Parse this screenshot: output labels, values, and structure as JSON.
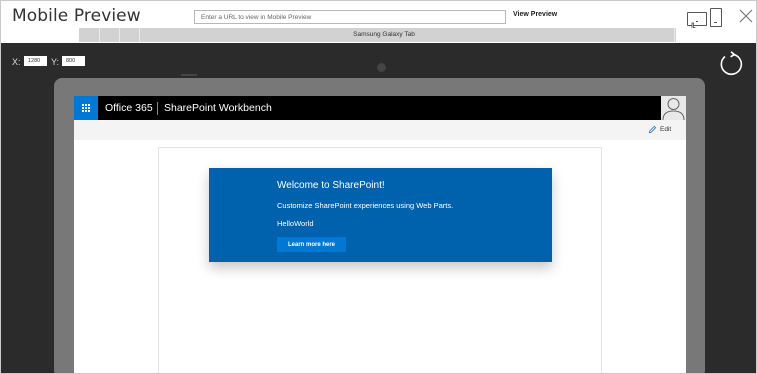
{
  "window": {
    "title": "Mobile Preview",
    "url_placeholder": "Enter a URL to view in Mobile Preview",
    "url_value": "",
    "view_button_label": "View Preview",
    "device_name": "Samsung Galaxy Tab",
    "icons": [
      "tablet-icon",
      "phone-icon",
      "mouse-cursor-icon",
      "close-icon",
      "rotate-icon"
    ]
  },
  "coords": {
    "x_label": "X:",
    "x_value": "1280",
    "y_label": "Y:",
    "y_value": "800"
  },
  "sharepoint": {
    "brand": "Office 365",
    "app_title": "SharePoint Workbench",
    "edit_label": "Edit",
    "accent": "#0078d4",
    "hero_color": "#0062ad"
  },
  "webpart": {
    "title": "Welcome to SharePoint!",
    "subtitle": "Customize SharePoint experiences using Web Parts.",
    "description": "HelloWorld",
    "button_label": "Learn more here"
  }
}
